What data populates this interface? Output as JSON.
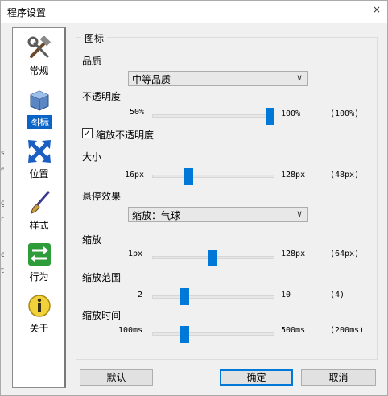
{
  "window": {
    "title": "程序设置",
    "close_glyph": "×"
  },
  "edge_fragments": [
    "s",
    "e",
    "g",
    "n",
    "e",
    "t"
  ],
  "sidebar": {
    "items": [
      {
        "id": "general",
        "label": "常规",
        "icon": "tools-icon",
        "selected": false
      },
      {
        "id": "icon",
        "label": "图标",
        "icon": "icon-box-icon",
        "selected": true
      },
      {
        "id": "position",
        "label": "位置",
        "icon": "arrows-icon",
        "selected": false
      },
      {
        "id": "style",
        "label": "样式",
        "icon": "brush-icon",
        "selected": false
      },
      {
        "id": "behavior",
        "label": "行为",
        "icon": "swap-arrows-icon",
        "selected": false
      },
      {
        "id": "about",
        "label": "关于",
        "icon": "info-icon",
        "selected": false
      }
    ]
  },
  "group": {
    "title": "图标"
  },
  "quality": {
    "label": "品质",
    "value": "中等品质",
    "arrow": "∨"
  },
  "opacity": {
    "label": "不透明度",
    "min": "50%",
    "max": "100%",
    "current": "(100%)",
    "level_fraction": 1.0
  },
  "zoom_opacity": {
    "label": "缩放不透明度",
    "checked": true,
    "check_glyph": "✓"
  },
  "size": {
    "label": "大小",
    "min": "16px",
    "max": "128px",
    "current": "(48px)",
    "value": 48,
    "range": [
      16,
      128
    ]
  },
  "hover_effect": {
    "label": "悬停效果",
    "value": "缩放：气球",
    "arrow": "∨"
  },
  "zoom": {
    "label": "缩放",
    "min": "1px",
    "max": "128px",
    "current": "(64px)",
    "value": 64,
    "range": [
      1,
      128
    ]
  },
  "zoom_range": {
    "label": "缩放范围",
    "min": "2",
    "max": "10",
    "current": "(4)",
    "value": 4,
    "range": [
      2,
      10
    ]
  },
  "zoom_time": {
    "label": "缩放时间",
    "min": "100ms",
    "max": "500ms",
    "current": "(200ms)",
    "value": 200,
    "range": [
      100,
      500
    ]
  },
  "buttons": {
    "default": "默认",
    "ok": "确定",
    "cancel": "取消"
  }
}
